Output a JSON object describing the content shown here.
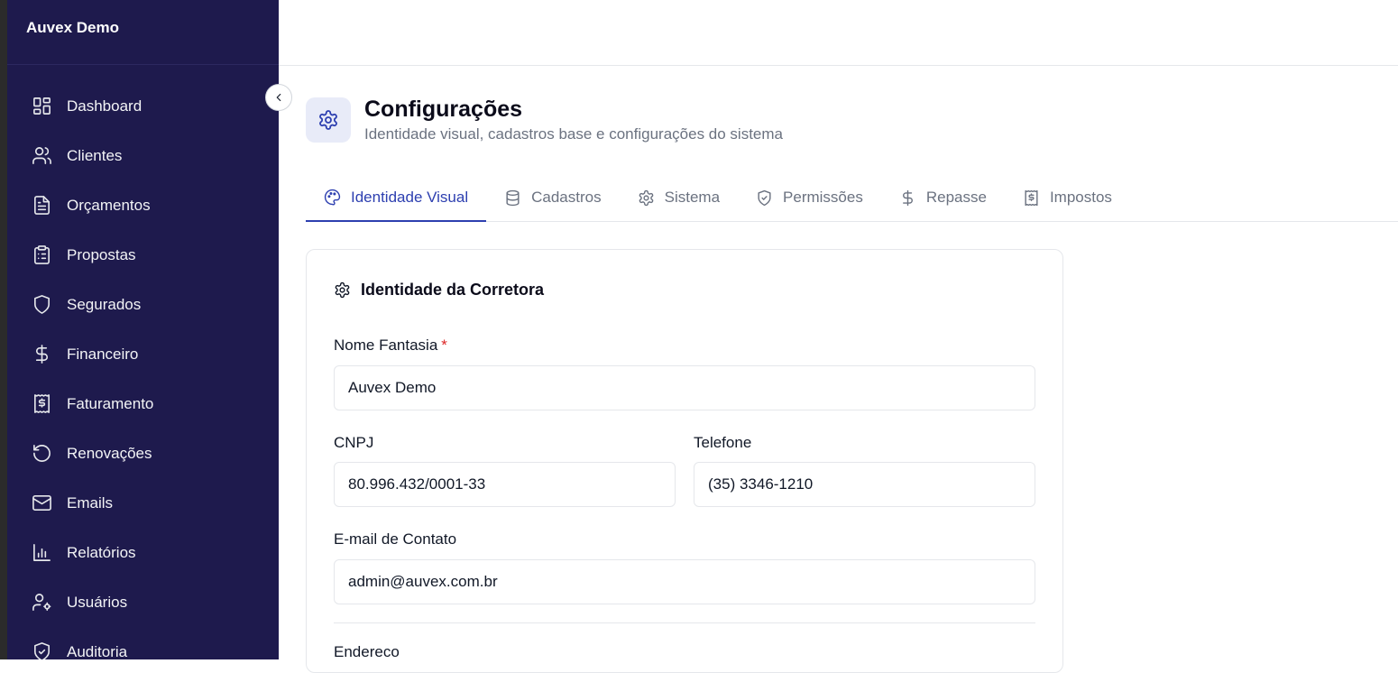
{
  "sidebar": {
    "brand": "Auvex Demo",
    "items": [
      {
        "label": "Dashboard",
        "icon": "dashboard-icon"
      },
      {
        "label": "Clientes",
        "icon": "users-icon"
      },
      {
        "label": "Orçamentos",
        "icon": "file-text-icon"
      },
      {
        "label": "Propostas",
        "icon": "clipboard-icon"
      },
      {
        "label": "Segurados",
        "icon": "shield-icon"
      },
      {
        "label": "Financeiro",
        "icon": "dollar-icon"
      },
      {
        "label": "Faturamento",
        "icon": "receipt-icon"
      },
      {
        "label": "Renovações",
        "icon": "rotate-ccw-icon"
      },
      {
        "label": "Emails",
        "icon": "mail-icon"
      },
      {
        "label": "Relatórios",
        "icon": "bar-chart-icon"
      },
      {
        "label": "Usuários",
        "icon": "user-cog-icon"
      },
      {
        "label": "Auditoria",
        "icon": "shield-check-icon"
      }
    ]
  },
  "page": {
    "title": "Configurações",
    "subtitle": "Identidade visual, cadastros base e configurações do sistema"
  },
  "tabs": [
    {
      "label": "Identidade Visual",
      "icon": "palette-icon",
      "active": true
    },
    {
      "label": "Cadastros",
      "icon": "database-icon",
      "active": false
    },
    {
      "label": "Sistema",
      "icon": "gear-icon",
      "active": false
    },
    {
      "label": "Permissões",
      "icon": "shield-check-icon",
      "active": false
    },
    {
      "label": "Repasse",
      "icon": "dollar-icon",
      "active": false
    },
    {
      "label": "Impostos",
      "icon": "receipt-icon",
      "active": false
    }
  ],
  "card": {
    "title": "Identidade da Corretora",
    "fields": {
      "nome_fantasia": {
        "label": "Nome Fantasia",
        "required_mark": "*",
        "value": "Auvex Demo"
      },
      "cnpj": {
        "label": "CNPJ",
        "value": "80.996.432/0001-33"
      },
      "telefone": {
        "label": "Telefone",
        "value": "(35) 3346-1210"
      },
      "email": {
        "label": "E-mail de Contato",
        "value": "admin@auvex.com.br"
      },
      "endereco": {
        "label": "Endereco"
      }
    }
  },
  "colors": {
    "sidebar_bg": "#1e1a4d",
    "accent": "#2d3fb0",
    "required": "#dc2626"
  }
}
